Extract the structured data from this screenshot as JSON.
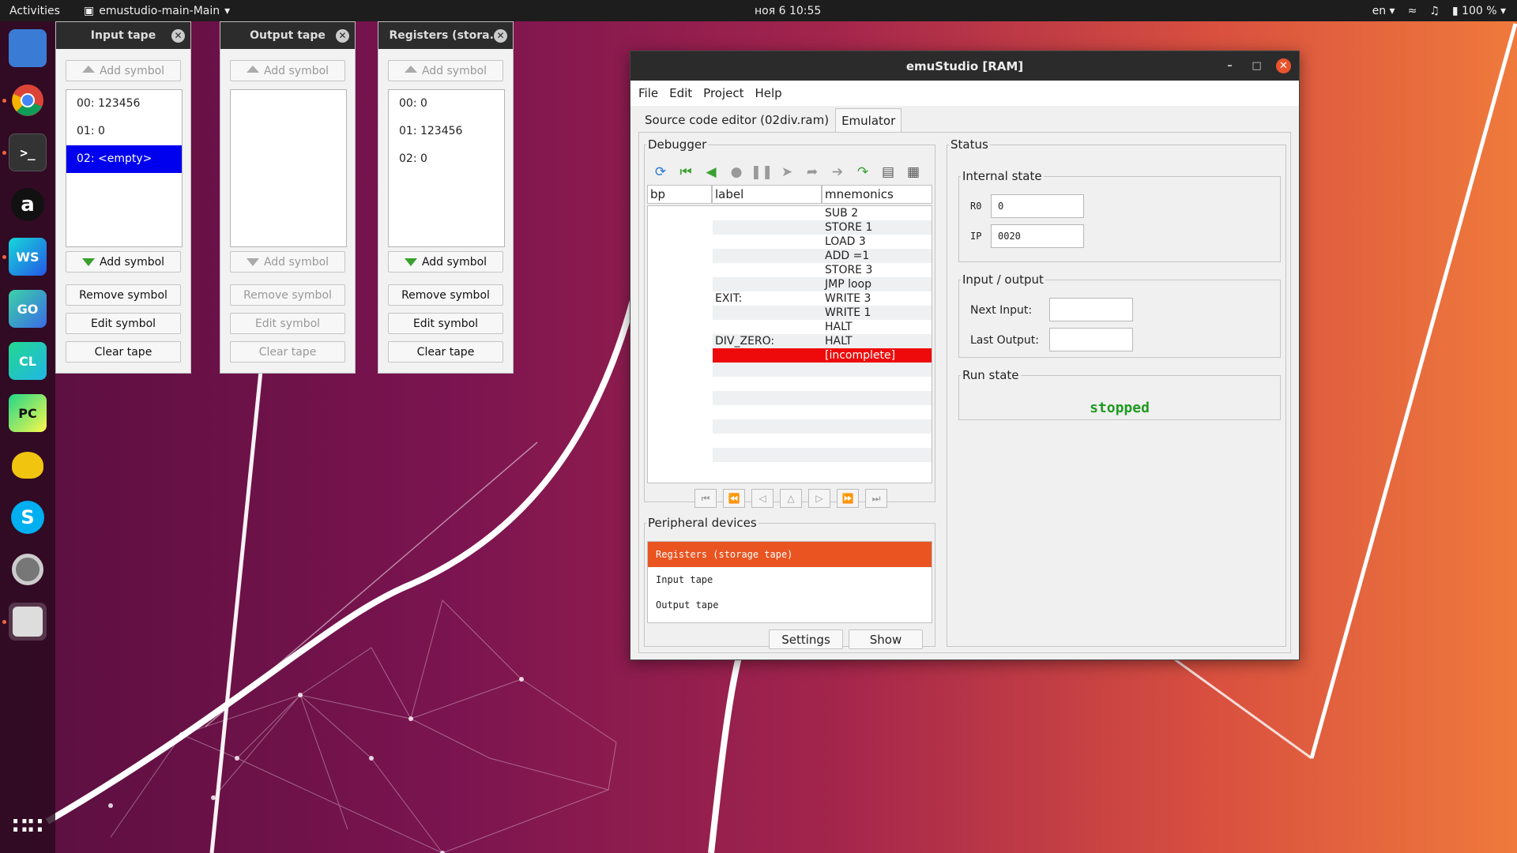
{
  "topbar": {
    "activities": "Activities",
    "app_name": "emustudio-main-Main",
    "clock": "ноя 6  10:55",
    "lang": "en",
    "battery": "100 %"
  },
  "dock": {
    "items": [
      {
        "icon": "files-icon",
        "text": ""
      },
      {
        "icon": "chrome-icon",
        "text": ""
      },
      {
        "icon": "terminal-icon",
        "text": ">_"
      },
      {
        "icon": "amazon-icon",
        "text": "a"
      },
      {
        "icon": "webstorm-icon",
        "text": "WS"
      },
      {
        "icon": "goland-icon",
        "text": "GO"
      },
      {
        "icon": "clion-icon",
        "text": "CL"
      },
      {
        "icon": "pycharm-icon",
        "text": "PC"
      },
      {
        "icon": "teapot-icon",
        "text": ""
      },
      {
        "icon": "skype-icon",
        "text": "S"
      },
      {
        "icon": "settings-icon",
        "text": ""
      },
      {
        "icon": "java-app-icon",
        "text": ""
      }
    ]
  },
  "tapes": [
    {
      "title": "Input tape",
      "add_top": "Add symbol",
      "rows": [
        "00: 123456",
        "01: 0",
        "02: <empty>"
      ],
      "selected": 2,
      "add_bottom": "Add symbol",
      "remove": "Remove symbol",
      "edit": "Edit symbol",
      "clear": "Clear tape"
    },
    {
      "title": "Output tape",
      "add_top": "Add symbol",
      "rows": [],
      "selected": -1,
      "add_bottom": "Add symbol",
      "remove": "Remove symbol",
      "edit": "Edit symbol",
      "clear": "Clear tape"
    },
    {
      "title": "Registers (stora...",
      "add_top": "Add symbol",
      "rows": [
        "00: 0",
        "01: 123456",
        "02: 0"
      ],
      "selected": -1,
      "add_bottom": "Add symbol",
      "remove": "Remove symbol",
      "edit": "Edit symbol",
      "clear": "Clear tape"
    }
  ],
  "window": {
    "title": "emuStudio [RAM]",
    "menu": [
      "File",
      "Edit",
      "Project",
      "Help"
    ],
    "tabs": [
      "Source code editor (02div.ram)",
      "Emulator"
    ],
    "debugger": {
      "legend": "Debugger",
      "columns": [
        "bp",
        "label",
        "mnemonics"
      ],
      "rows": [
        {
          "label": "",
          "mnemonic": "SUB 2"
        },
        {
          "label": "",
          "mnemonic": "STORE 1"
        },
        {
          "label": "",
          "mnemonic": "LOAD 3"
        },
        {
          "label": "",
          "mnemonic": "ADD =1"
        },
        {
          "label": "",
          "mnemonic": "STORE 3"
        },
        {
          "label": "",
          "mnemonic": "JMP loop"
        },
        {
          "label": "EXIT:",
          "mnemonic": "WRITE 3"
        },
        {
          "label": "",
          "mnemonic": "WRITE 1"
        },
        {
          "label": "",
          "mnemonic": "HALT"
        },
        {
          "label": "DIV_ZERO:",
          "mnemonic": "HALT"
        },
        {
          "label": "",
          "mnemonic": "[incomplete]"
        },
        {
          "label": "",
          "mnemonic": ""
        },
        {
          "label": "",
          "mnemonic": ""
        },
        {
          "label": "",
          "mnemonic": ""
        },
        {
          "label": "",
          "mnemonic": ""
        },
        {
          "label": "",
          "mnemonic": ""
        },
        {
          "label": "",
          "mnemonic": ""
        },
        {
          "label": "",
          "mnemonic": ""
        },
        {
          "label": "",
          "mnemonic": ""
        }
      ],
      "current_row": 10
    },
    "peripherals": {
      "legend": "Peripheral devices",
      "devices": [
        "Registers (storage tape)",
        "Input tape",
        "Output tape"
      ],
      "selected": 0,
      "settings": "Settings",
      "show": "Show"
    },
    "status": {
      "legend": "Status",
      "internal_legend": "Internal state",
      "r0_label": "R0",
      "r0_value": "0",
      "ip_label": "IP",
      "ip_value": "0020",
      "io_legend": "Input / output",
      "next_input_label": "Next Input:",
      "next_input_value": "",
      "last_output_label": "Last Output:",
      "last_output_value": "",
      "run_legend": "Run state",
      "run_state": "stopped"
    }
  },
  "colors": {
    "selected_blue": "#0000ee",
    "current_row_red": "#ee0a0a",
    "device_selected": "#e95420",
    "run_green": "#1f9a1f"
  }
}
